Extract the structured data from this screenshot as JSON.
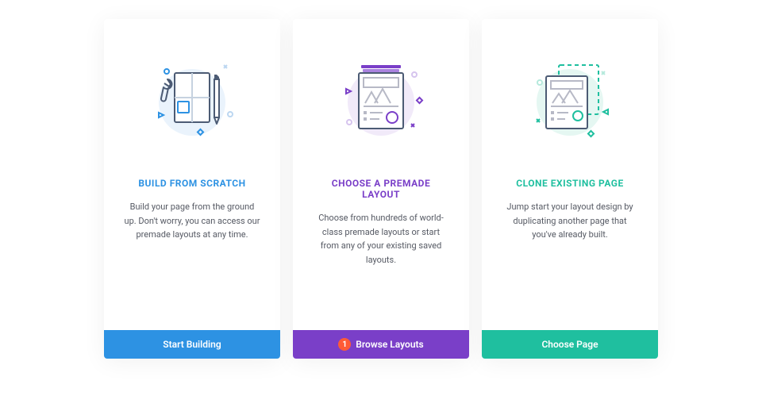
{
  "cards": [
    {
      "title": "BUILD FROM SCRATCH",
      "desc": "Build your page from the ground up. Don't worry, you can access our premade layouts at any time.",
      "button": "Start Building"
    },
    {
      "title": "CHOOSE A PREMADE LAYOUT",
      "desc": "Choose from hundreds of world-class premade layouts or start from any of your existing saved layouts.",
      "button": "Browse Layouts",
      "badge": "1"
    },
    {
      "title": "CLONE EXISTING PAGE",
      "desc": "Jump start your layout design by duplicating another page that you've already built.",
      "button": "Choose Page"
    }
  ]
}
